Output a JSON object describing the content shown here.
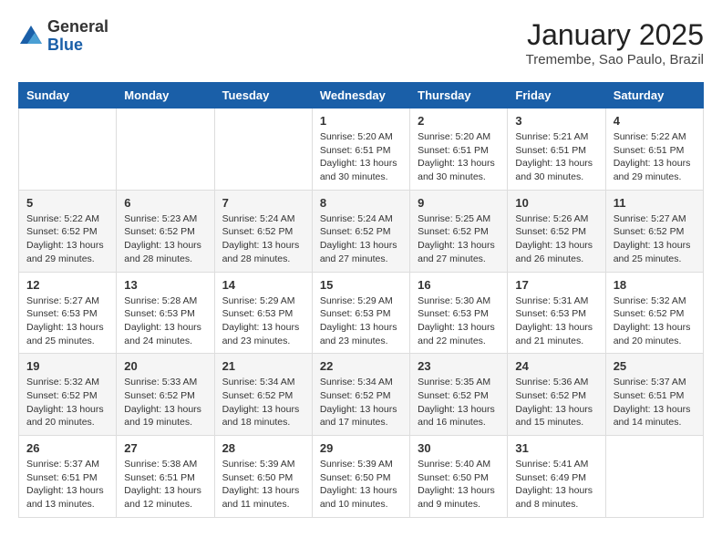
{
  "header": {
    "logo_general": "General",
    "logo_blue": "Blue",
    "month_title": "January 2025",
    "location": "Tremembe, Sao Paulo, Brazil"
  },
  "days_of_week": [
    "Sunday",
    "Monday",
    "Tuesday",
    "Wednesday",
    "Thursday",
    "Friday",
    "Saturday"
  ],
  "weeks": [
    [
      {
        "num": "",
        "info": ""
      },
      {
        "num": "",
        "info": ""
      },
      {
        "num": "",
        "info": ""
      },
      {
        "num": "1",
        "info": "Sunrise: 5:20 AM\nSunset: 6:51 PM\nDaylight: 13 hours and 30 minutes."
      },
      {
        "num": "2",
        "info": "Sunrise: 5:20 AM\nSunset: 6:51 PM\nDaylight: 13 hours and 30 minutes."
      },
      {
        "num": "3",
        "info": "Sunrise: 5:21 AM\nSunset: 6:51 PM\nDaylight: 13 hours and 30 minutes."
      },
      {
        "num": "4",
        "info": "Sunrise: 5:22 AM\nSunset: 6:51 PM\nDaylight: 13 hours and 29 minutes."
      }
    ],
    [
      {
        "num": "5",
        "info": "Sunrise: 5:22 AM\nSunset: 6:52 PM\nDaylight: 13 hours and 29 minutes."
      },
      {
        "num": "6",
        "info": "Sunrise: 5:23 AM\nSunset: 6:52 PM\nDaylight: 13 hours and 28 minutes."
      },
      {
        "num": "7",
        "info": "Sunrise: 5:24 AM\nSunset: 6:52 PM\nDaylight: 13 hours and 28 minutes."
      },
      {
        "num": "8",
        "info": "Sunrise: 5:24 AM\nSunset: 6:52 PM\nDaylight: 13 hours and 27 minutes."
      },
      {
        "num": "9",
        "info": "Sunrise: 5:25 AM\nSunset: 6:52 PM\nDaylight: 13 hours and 27 minutes."
      },
      {
        "num": "10",
        "info": "Sunrise: 5:26 AM\nSunset: 6:52 PM\nDaylight: 13 hours and 26 minutes."
      },
      {
        "num": "11",
        "info": "Sunrise: 5:27 AM\nSunset: 6:52 PM\nDaylight: 13 hours and 25 minutes."
      }
    ],
    [
      {
        "num": "12",
        "info": "Sunrise: 5:27 AM\nSunset: 6:53 PM\nDaylight: 13 hours and 25 minutes."
      },
      {
        "num": "13",
        "info": "Sunrise: 5:28 AM\nSunset: 6:53 PM\nDaylight: 13 hours and 24 minutes."
      },
      {
        "num": "14",
        "info": "Sunrise: 5:29 AM\nSunset: 6:53 PM\nDaylight: 13 hours and 23 minutes."
      },
      {
        "num": "15",
        "info": "Sunrise: 5:29 AM\nSunset: 6:53 PM\nDaylight: 13 hours and 23 minutes."
      },
      {
        "num": "16",
        "info": "Sunrise: 5:30 AM\nSunset: 6:53 PM\nDaylight: 13 hours and 22 minutes."
      },
      {
        "num": "17",
        "info": "Sunrise: 5:31 AM\nSunset: 6:53 PM\nDaylight: 13 hours and 21 minutes."
      },
      {
        "num": "18",
        "info": "Sunrise: 5:32 AM\nSunset: 6:52 PM\nDaylight: 13 hours and 20 minutes."
      }
    ],
    [
      {
        "num": "19",
        "info": "Sunrise: 5:32 AM\nSunset: 6:52 PM\nDaylight: 13 hours and 20 minutes."
      },
      {
        "num": "20",
        "info": "Sunrise: 5:33 AM\nSunset: 6:52 PM\nDaylight: 13 hours and 19 minutes."
      },
      {
        "num": "21",
        "info": "Sunrise: 5:34 AM\nSunset: 6:52 PM\nDaylight: 13 hours and 18 minutes."
      },
      {
        "num": "22",
        "info": "Sunrise: 5:34 AM\nSunset: 6:52 PM\nDaylight: 13 hours and 17 minutes."
      },
      {
        "num": "23",
        "info": "Sunrise: 5:35 AM\nSunset: 6:52 PM\nDaylight: 13 hours and 16 minutes."
      },
      {
        "num": "24",
        "info": "Sunrise: 5:36 AM\nSunset: 6:52 PM\nDaylight: 13 hours and 15 minutes."
      },
      {
        "num": "25",
        "info": "Sunrise: 5:37 AM\nSunset: 6:51 PM\nDaylight: 13 hours and 14 minutes."
      }
    ],
    [
      {
        "num": "26",
        "info": "Sunrise: 5:37 AM\nSunset: 6:51 PM\nDaylight: 13 hours and 13 minutes."
      },
      {
        "num": "27",
        "info": "Sunrise: 5:38 AM\nSunset: 6:51 PM\nDaylight: 13 hours and 12 minutes."
      },
      {
        "num": "28",
        "info": "Sunrise: 5:39 AM\nSunset: 6:50 PM\nDaylight: 13 hours and 11 minutes."
      },
      {
        "num": "29",
        "info": "Sunrise: 5:39 AM\nSunset: 6:50 PM\nDaylight: 13 hours and 10 minutes."
      },
      {
        "num": "30",
        "info": "Sunrise: 5:40 AM\nSunset: 6:50 PM\nDaylight: 13 hours and 9 minutes."
      },
      {
        "num": "31",
        "info": "Sunrise: 5:41 AM\nSunset: 6:49 PM\nDaylight: 13 hours and 8 minutes."
      },
      {
        "num": "",
        "info": ""
      }
    ]
  ]
}
